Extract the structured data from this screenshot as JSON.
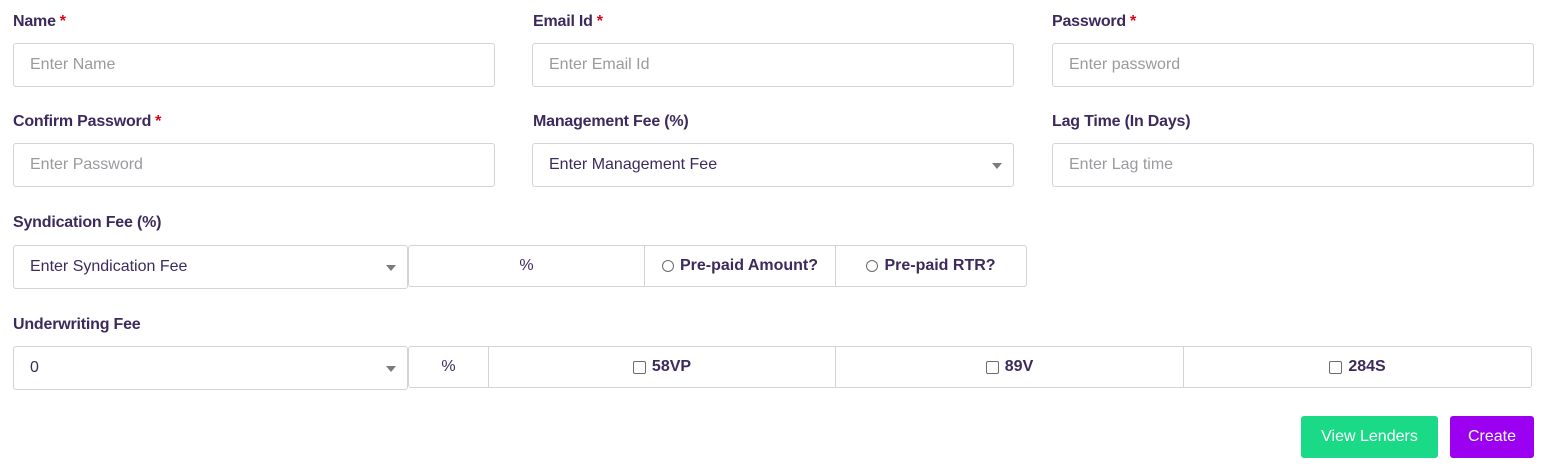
{
  "form": {
    "name": {
      "label": "Name",
      "required_mark": "*",
      "placeholder": "Enter Name"
    },
    "email": {
      "label": "Email Id",
      "required_mark": "*",
      "placeholder": "Enter Email Id"
    },
    "password": {
      "label": "Password",
      "required_mark": "*",
      "placeholder": "Enter password"
    },
    "confirm_password": {
      "label": "Confirm Password",
      "required_mark": "*",
      "placeholder": "Enter Password"
    },
    "management_fee": {
      "label": "Management Fee (%)",
      "value": "Enter Management Fee"
    },
    "lag_time": {
      "label": "Lag Time (In Days)",
      "placeholder": "Enter Lag time"
    },
    "syndication_fee": {
      "label": "Syndication Fee (%)",
      "value": "Enter Syndication Fee",
      "unit": "%",
      "options": [
        "Pre-paid Amount?",
        "Pre-paid RTR?"
      ]
    },
    "underwriting_fee": {
      "label": "Underwriting Fee",
      "value": "0",
      "unit": "%",
      "options": [
        "58VP",
        "89V",
        "284S"
      ]
    }
  },
  "actions": {
    "view_lenders": "View Lenders",
    "create": "Create"
  },
  "colors": {
    "label": "#3d2a5c",
    "required": "#e0001b",
    "view_lenders_button": "#1ad987",
    "create_button": "#9b00f0"
  }
}
